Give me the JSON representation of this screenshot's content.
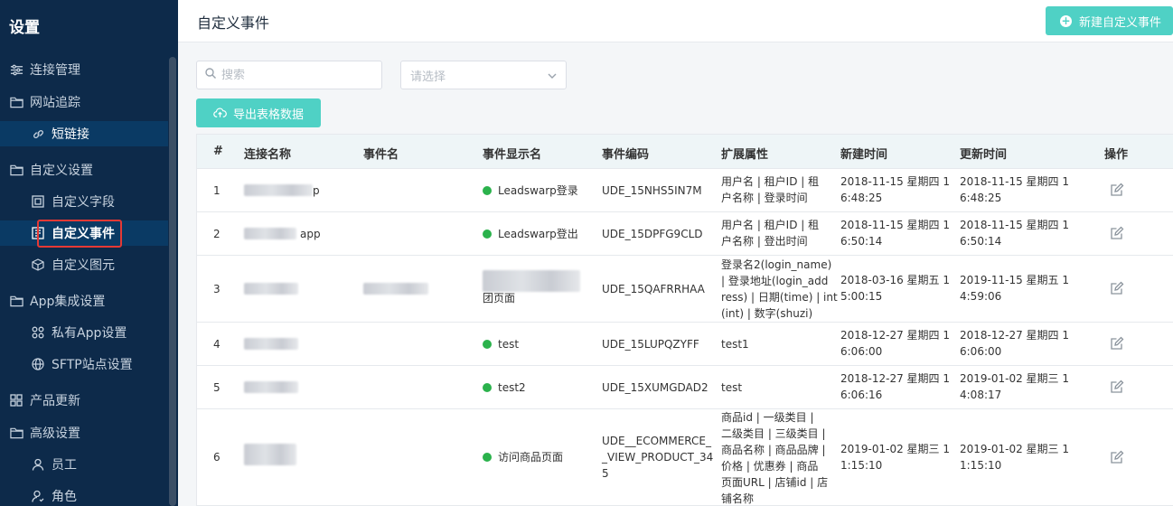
{
  "sidebar": {
    "title": "设置",
    "items": [
      {
        "label": "连接管理",
        "icon": "sliders-icon"
      },
      {
        "label": "网站追踪",
        "icon": "folder-icon"
      },
      {
        "label": "短链接",
        "icon": "link-icon"
      },
      {
        "label": "自定义设置",
        "icon": "folder-icon"
      },
      {
        "label": "自定义字段",
        "icon": "field-icon"
      },
      {
        "label": "自定义事件",
        "icon": "event-icon"
      },
      {
        "label": "自定义图元",
        "icon": "cube-icon"
      },
      {
        "label": "App集成设置",
        "icon": "folder-icon"
      },
      {
        "label": "私有App设置",
        "icon": "apps-icon"
      },
      {
        "label": "SFTP站点设置",
        "icon": "globe-icon"
      },
      {
        "label": "产品更新",
        "icon": "grid-icon"
      },
      {
        "label": "高级设置",
        "icon": "folder-icon"
      },
      {
        "label": "员工",
        "icon": "user-icon"
      },
      {
        "label": "角色",
        "icon": "role-icon"
      }
    ]
  },
  "header": {
    "title": "自定义事件",
    "new_button": "新建自定义事件"
  },
  "toolbar": {
    "search_placeholder": "搜索",
    "select_placeholder": "请选择",
    "export_label": "导出表格数据"
  },
  "table": {
    "columns": [
      "#",
      "连接名称",
      "事件名",
      "事件显示名",
      "事件编码",
      "扩展属性",
      "新建时间",
      "更新时间",
      "操作"
    ],
    "rows": [
      {
        "num": "1",
        "conn": "p",
        "event": "",
        "display": "Leadswarp登录",
        "code": [
          "UDE_15NHS5IN7M"
        ],
        "ext": [
          "用户名 | 租户ID | 租",
          "户名称 | 登录时间"
        ],
        "created": [
          "2018-11-15 星期四 1",
          "6:48:25"
        ],
        "updated": [
          "2018-11-15 星期四 1",
          "6:48:25"
        ]
      },
      {
        "num": "2",
        "conn": "app",
        "event": "",
        "display": "Leadswarp登出",
        "code": [
          "UDE_15DPFG9CLD"
        ],
        "ext": [
          "用户名 | 租户ID | 租",
          "户名称 | 登出时间"
        ],
        "created": [
          "2018-11-15 星期四 1",
          "6:50:14"
        ],
        "updated": [
          "2018-11-15 星期四 1",
          "6:50:14"
        ]
      },
      {
        "num": "3",
        "conn": "",
        "event": "",
        "display": "团页面",
        "code": [
          "UDE_15QAFRRHAA"
        ],
        "ext": [
          "登录名2(login_name)",
          "| 登录地址(login_add",
          "ress) | 日期(time) | int",
          "(int) | 数字(shuzi)"
        ],
        "created": [
          "2018-03-16 星期五 1",
          "5:00:15"
        ],
        "updated": [
          "2019-11-15 星期五 1",
          "4:59:06"
        ]
      },
      {
        "num": "4",
        "conn": "",
        "event": "",
        "display": "test",
        "code": [
          "UDE_15LUPQZYFF"
        ],
        "ext": [
          "test1"
        ],
        "created": [
          "2018-12-27 星期四 1",
          "6:06:00"
        ],
        "updated": [
          "2018-12-27 星期四 1",
          "6:06:00"
        ]
      },
      {
        "num": "5",
        "conn": "",
        "event": "",
        "display": "test2",
        "code": [
          "UDE_15XUMGDAD2"
        ],
        "ext": [
          "test"
        ],
        "created": [
          "2018-12-27 星期四 1",
          "6:06:16"
        ],
        "updated": [
          "2019-01-02 星期三 1",
          "4:08:17"
        ]
      },
      {
        "num": "6",
        "conn": "",
        "event": "",
        "display": "访问商品页面",
        "code": [
          "UDE__ECOMMERCE_",
          "_VIEW_PRODUCT_34",
          "5"
        ],
        "ext": [
          "商品id | 一级类目 |",
          "二级类目 | 三级类目 |",
          "商品名称 | 商品品牌 |",
          "价格 | 优惠券 | 商品",
          "页面URL | 店铺id | 店",
          "铺名称"
        ],
        "created": [
          "2019-01-02 星期三 1",
          "1:15:10"
        ],
        "updated": [
          "2019-01-02 星期三 1",
          "1:15:10"
        ]
      }
    ]
  },
  "colors": {
    "sidebar_bg": "#0d2a4a",
    "accent": "#4fd1c5",
    "active_item": "#0a3a64",
    "status_green": "#2bb24c",
    "highlight_border": "#e53935"
  }
}
